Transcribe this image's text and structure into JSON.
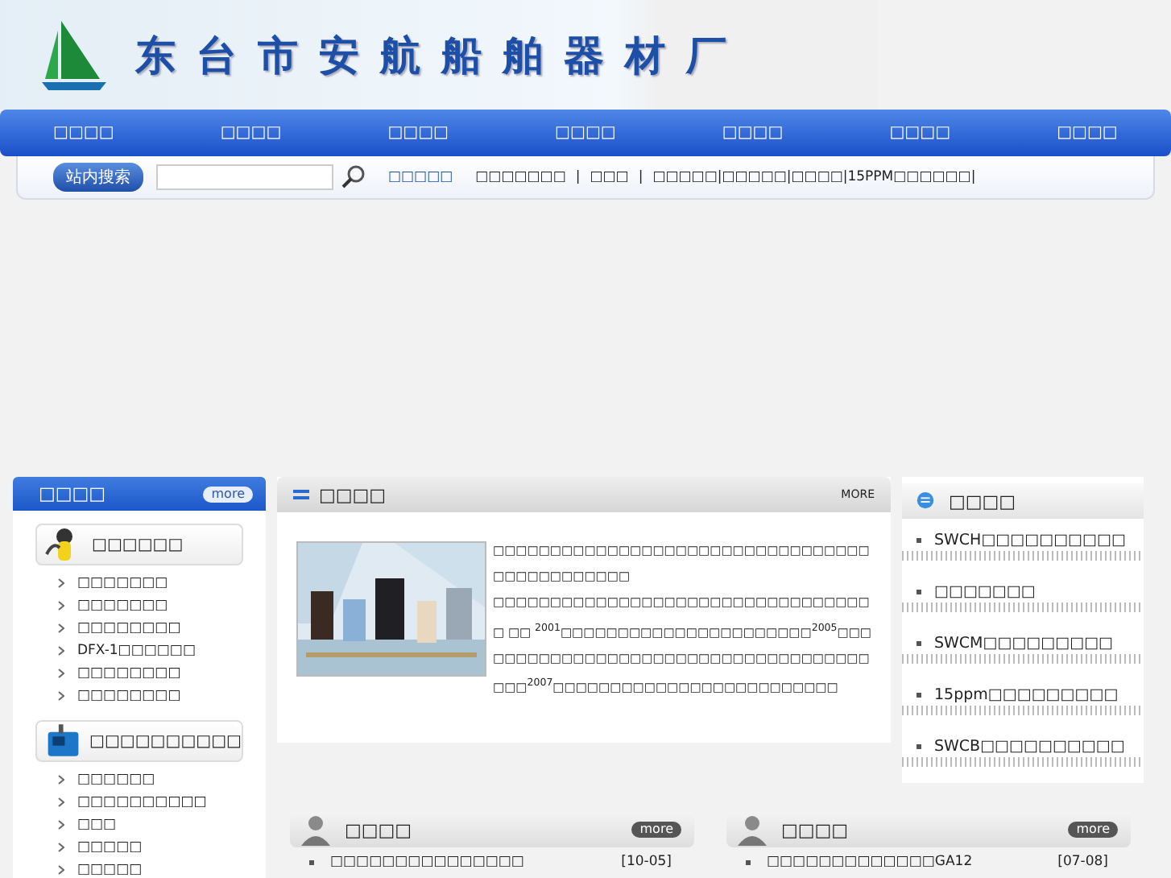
{
  "header": {
    "title": "东台市安航船舶器材厂"
  },
  "nav": [
    "□□□□",
    "□□□□",
    "□□□□",
    "□□□□",
    "□□□□",
    "□□□□",
    "□□□□"
  ],
  "search": {
    "button": "站内搜索"
  },
  "quick_links": {
    "label": "□□□□□",
    "items": [
      "□□□□□□□",
      "|",
      "□□□",
      "|",
      "□□□□□|□□□□□|□□□□|15PPM□□□□□□|"
    ]
  },
  "product_panel": {
    "title": "□□□□",
    "more": "more",
    "categories": [
      {
        "name": "□□□□□□",
        "items": [
          "□□□□□□□",
          "□□□□□□□",
          "□□□□□□□□",
          "DFX-1□□□□□□",
          "□□□□□□□□",
          "□□□□□□□□"
        ]
      },
      {
        "name": "□□□□□□□□□□",
        "items": [
          "□□□□□□",
          "□□□□□□□□□□",
          "□□□",
          "□□□□□",
          "□□□□□"
        ]
      }
    ]
  },
  "about_panel": {
    "title": "□□□□",
    "more": "MORE",
    "paragraphs": [
      "□□□□□□□□□□□□□□□□□□□□□□□□□□□□□□□□□□□□□□□□□□□□□",
      "□□□□□□□□□□□□□□□□□□□□□□□□□□□□□□□□□□ □□ $^{2001}$□□□□□□□□□□□□□□□□□□□□□□$^{2005}$□□□□□□□□□□□□□□□□□□□□□□□□□□□□□□□□□□□□□□□$^{2007}$□□□□□□□□□□□□□□□□□□□□□□□□□"
    ]
  },
  "service_panel": {
    "title": "□□□□",
    "items": [
      "SWCH□□□□□□□□□□",
      "□□□□□□□",
      "SWCM□□□□□□□□□",
      "15ppm□□□□□□□□□",
      "SWCB□□□□□□□□□□"
    ]
  },
  "news_panels": [
    {
      "title": "□□□□",
      "more": "more",
      "items": [
        {
          "text": "□□□□□□□□□□□□□□□",
          "date": "[10-05]"
        }
      ]
    },
    {
      "title": "□□□□",
      "more": "more",
      "items": [
        {
          "text": "□□□□□□□□□□□□□GA12",
          "date": "[07-08]"
        }
      ]
    }
  ]
}
